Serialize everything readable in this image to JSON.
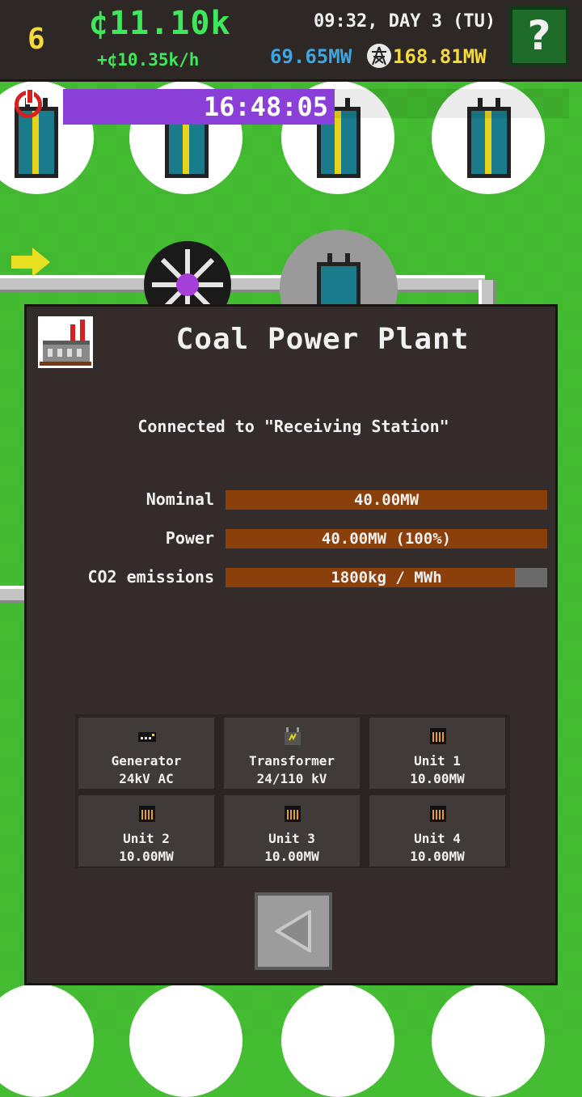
{
  "hud": {
    "level": "6",
    "money": "¢11.10k",
    "income": "+¢10.35k/h",
    "clock": "09:32, DAY 3 (TU)",
    "power_consumption": "69.65MW",
    "power_production": "168.81MW",
    "help_label": "?"
  },
  "world": {
    "timer": "16:48:05"
  },
  "dialog": {
    "title": "Coal Power Plant",
    "connection": "Connected to \"Receiving Station\"",
    "stats": [
      {
        "label": "Nominal",
        "value": "40.00MW",
        "fill": 1.0
      },
      {
        "label": "Power",
        "value": "40.00MW (100%)",
        "fill": 1.0
      },
      {
        "label": "CO2 emissions",
        "value": "1800kg / MWh",
        "fill": 0.9
      }
    ],
    "components": [
      {
        "name": "Generator",
        "spec": "24kV AC",
        "icon": "generator-icon"
      },
      {
        "name": "Transformer",
        "spec": "24/110 kV",
        "icon": "transformer-icon"
      },
      {
        "name": "Unit 1",
        "spec": "10.00MW",
        "icon": "unit-icon"
      },
      {
        "name": "Unit 2",
        "spec": "10.00MW",
        "icon": "unit-icon"
      },
      {
        "name": "Unit 3",
        "spec": "10.00MW",
        "icon": "unit-icon"
      },
      {
        "name": "Unit 4",
        "spec": "10.00MW",
        "icon": "unit-icon"
      }
    ]
  },
  "colors": {
    "money": "#3fe85a",
    "consumption": "#3fa6e4",
    "production": "#f5d93a",
    "bar_fill": "#8b3f0b",
    "timer": "#8a3fd8"
  }
}
